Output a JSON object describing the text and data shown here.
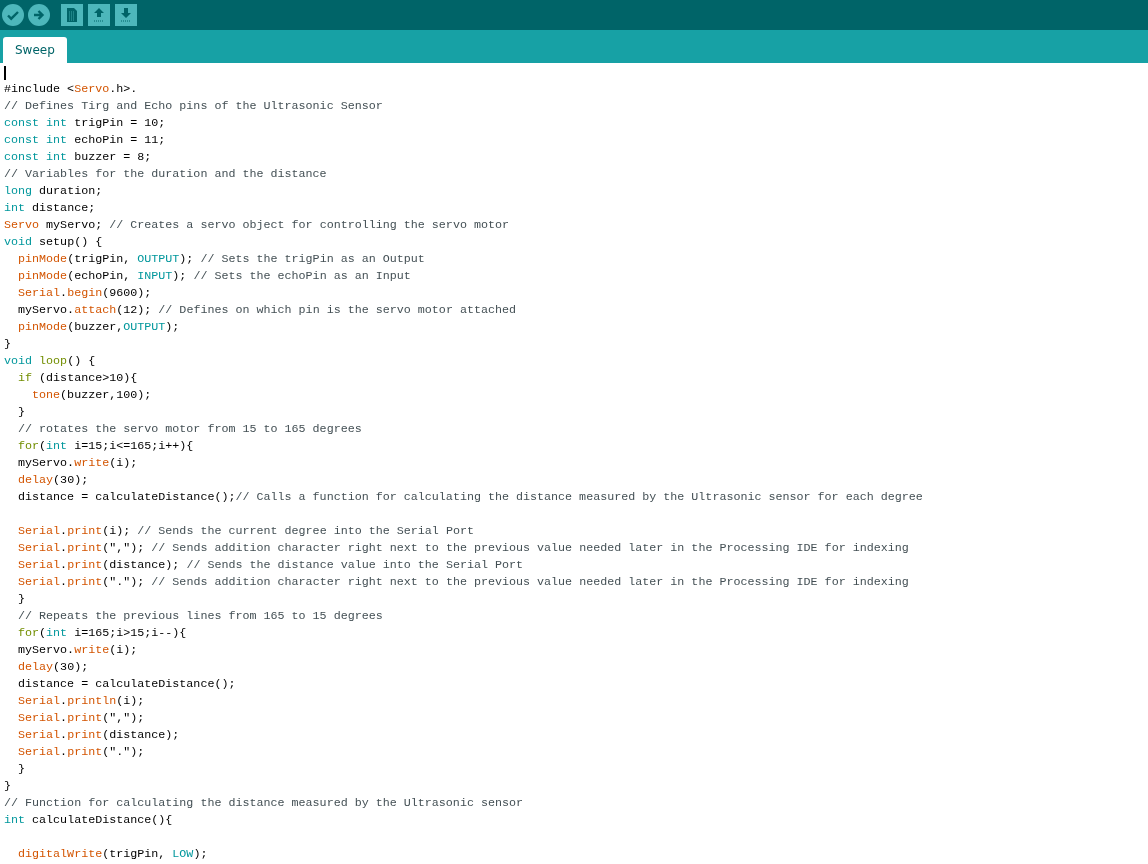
{
  "tabs": [
    {
      "label": "Sweep",
      "selected": true
    }
  ],
  "editor": {
    "lines": [
      {
        "cursor": true
      },
      {
        "tokens": [
          {
            "kind": "plain",
            "text": "#include <"
          },
          {
            "kind": "func",
            "text": "Servo"
          },
          {
            "kind": "plain",
            "text": ".h>."
          }
        ]
      },
      {
        "tokens": [
          {
            "kind": "comment",
            "text": "// Defines Tirg and Echo pins of the Ultrasonic Sensor"
          }
        ]
      },
      {
        "tokens": [
          {
            "kind": "type",
            "text": "const int"
          },
          {
            "kind": "plain",
            "text": " trigPin = 10;"
          }
        ]
      },
      {
        "tokens": [
          {
            "kind": "type",
            "text": "const int"
          },
          {
            "kind": "plain",
            "text": " echoPin = 11;"
          }
        ]
      },
      {
        "tokens": [
          {
            "kind": "type",
            "text": "const int"
          },
          {
            "kind": "plain",
            "text": " buzzer = 8;"
          }
        ]
      },
      {
        "tokens": [
          {
            "kind": "comment",
            "text": "// Variables for the duration and the distance"
          }
        ]
      },
      {
        "tokens": [
          {
            "kind": "type",
            "text": "long"
          },
          {
            "kind": "plain",
            "text": " duration;"
          }
        ]
      },
      {
        "tokens": [
          {
            "kind": "type",
            "text": "int"
          },
          {
            "kind": "plain",
            "text": " distance;"
          }
        ]
      },
      {
        "tokens": [
          {
            "kind": "func",
            "text": "Servo"
          },
          {
            "kind": "plain",
            "text": " myServo; "
          },
          {
            "kind": "comment",
            "text": "// Creates a servo object for controlling the servo motor"
          }
        ]
      },
      {
        "tokens": [
          {
            "kind": "type",
            "text": "void"
          },
          {
            "kind": "plain",
            "text": " setup() {"
          }
        ]
      },
      {
        "tokens": [
          {
            "kind": "func",
            "text": "  pinMode"
          },
          {
            "kind": "plain",
            "text": "(trigPin, "
          },
          {
            "kind": "type",
            "text": "OUTPUT"
          },
          {
            "kind": "plain",
            "text": "); "
          },
          {
            "kind": "comment",
            "text": "// Sets the trigPin as an Output"
          }
        ]
      },
      {
        "tokens": [
          {
            "kind": "func",
            "text": "  pinMode"
          },
          {
            "kind": "plain",
            "text": "(echoPin, "
          },
          {
            "kind": "type",
            "text": "INPUT"
          },
          {
            "kind": "plain",
            "text": "); "
          },
          {
            "kind": "comment",
            "text": "// Sets the echoPin as an Input"
          }
        ]
      },
      {
        "tokens": [
          {
            "kind": "func",
            "text": "  Serial"
          },
          {
            "kind": "plain",
            "text": "."
          },
          {
            "kind": "func",
            "text": "begin"
          },
          {
            "kind": "plain",
            "text": "(9600);"
          }
        ]
      },
      {
        "tokens": [
          {
            "kind": "plain",
            "text": "  myServo."
          },
          {
            "kind": "func",
            "text": "attach"
          },
          {
            "kind": "plain",
            "text": "(12); "
          },
          {
            "kind": "comment",
            "text": "// Defines on which pin is the servo motor attached"
          }
        ]
      },
      {
        "tokens": [
          {
            "kind": "func",
            "text": "  pinMode"
          },
          {
            "kind": "plain",
            "text": "(buzzer,"
          },
          {
            "kind": "type",
            "text": "OUTPUT"
          },
          {
            "kind": "plain",
            "text": ");"
          }
        ]
      },
      {
        "tokens": [
          {
            "kind": "plain",
            "text": "}"
          }
        ]
      },
      {
        "tokens": [
          {
            "kind": "type",
            "text": "void "
          },
          {
            "kind": "ctrl",
            "text": "loop"
          },
          {
            "kind": "plain",
            "text": "() {"
          }
        ]
      },
      {
        "tokens": [
          {
            "kind": "ctrl",
            "text": "  if"
          },
          {
            "kind": "plain",
            "text": " (distance>10){"
          }
        ]
      },
      {
        "tokens": [
          {
            "kind": "func",
            "text": "    tone"
          },
          {
            "kind": "plain",
            "text": "(buzzer,100);"
          }
        ]
      },
      {
        "tokens": [
          {
            "kind": "plain",
            "text": "  }"
          }
        ]
      },
      {
        "tokens": [
          {
            "kind": "comment",
            "text": "  // rotates the servo motor from 15 to 165 degrees"
          }
        ]
      },
      {
        "tokens": [
          {
            "kind": "ctrl",
            "text": "  for"
          },
          {
            "kind": "plain",
            "text": "("
          },
          {
            "kind": "type",
            "text": "int"
          },
          {
            "kind": "plain",
            "text": " i=15;i<=165;i++){"
          }
        ]
      },
      {
        "tokens": [
          {
            "kind": "plain",
            "text": "  myServo."
          },
          {
            "kind": "func",
            "text": "write"
          },
          {
            "kind": "plain",
            "text": "(i);"
          }
        ]
      },
      {
        "tokens": [
          {
            "kind": "func",
            "text": "  delay"
          },
          {
            "kind": "plain",
            "text": "(30);"
          }
        ]
      },
      {
        "tokens": [
          {
            "kind": "plain",
            "text": "  distance = calculateDistance();"
          },
          {
            "kind": "comment",
            "text": "// Calls a function for calculating the distance measured by the Ultrasonic sensor for each degree"
          }
        ]
      },
      {
        "kind": "blank"
      },
      {
        "tokens": [
          {
            "kind": "func",
            "text": "  Serial"
          },
          {
            "kind": "plain",
            "text": "."
          },
          {
            "kind": "func",
            "text": "print"
          },
          {
            "kind": "plain",
            "text": "(i); "
          },
          {
            "kind": "comment",
            "text": "// Sends the current degree into the Serial Port"
          }
        ]
      },
      {
        "tokens": [
          {
            "kind": "func",
            "text": "  Serial"
          },
          {
            "kind": "plain",
            "text": "."
          },
          {
            "kind": "func",
            "text": "print"
          },
          {
            "kind": "plain",
            "text": "(\",\"); "
          },
          {
            "kind": "comment",
            "text": "// Sends addition character right next to the previous value needed later in the Processing IDE for indexing"
          }
        ]
      },
      {
        "tokens": [
          {
            "kind": "func",
            "text": "  Serial"
          },
          {
            "kind": "plain",
            "text": "."
          },
          {
            "kind": "func",
            "text": "print"
          },
          {
            "kind": "plain",
            "text": "(distance); "
          },
          {
            "kind": "comment",
            "text": "// Sends the distance value into the Serial Port"
          }
        ]
      },
      {
        "tokens": [
          {
            "kind": "func",
            "text": "  Serial"
          },
          {
            "kind": "plain",
            "text": "."
          },
          {
            "kind": "func",
            "text": "print"
          },
          {
            "kind": "plain",
            "text": "(\".\"); "
          },
          {
            "kind": "comment",
            "text": "// Sends addition character right next to the previous value needed later in the Processing IDE for indexing"
          }
        ]
      },
      {
        "tokens": [
          {
            "kind": "plain",
            "text": "  }"
          }
        ]
      },
      {
        "tokens": [
          {
            "kind": "comment",
            "text": "  // Repeats the previous lines from 165 to 15 degrees"
          }
        ]
      },
      {
        "tokens": [
          {
            "kind": "ctrl",
            "text": "  for"
          },
          {
            "kind": "plain",
            "text": "("
          },
          {
            "kind": "type",
            "text": "int"
          },
          {
            "kind": "plain",
            "text": " i=165;i>15;i--){"
          }
        ]
      },
      {
        "tokens": [
          {
            "kind": "plain",
            "text": "  myServo."
          },
          {
            "kind": "func",
            "text": "write"
          },
          {
            "kind": "plain",
            "text": "(i);"
          }
        ]
      },
      {
        "tokens": [
          {
            "kind": "func",
            "text": "  delay"
          },
          {
            "kind": "plain",
            "text": "(30);"
          }
        ]
      },
      {
        "tokens": [
          {
            "kind": "plain",
            "text": "  distance = calculateDistance();"
          }
        ]
      },
      {
        "tokens": [
          {
            "kind": "func",
            "text": "  Serial"
          },
          {
            "kind": "plain",
            "text": "."
          },
          {
            "kind": "func",
            "text": "println"
          },
          {
            "kind": "plain",
            "text": "(i);"
          }
        ]
      },
      {
        "tokens": [
          {
            "kind": "func",
            "text": "  Serial"
          },
          {
            "kind": "plain",
            "text": "."
          },
          {
            "kind": "func",
            "text": "print"
          },
          {
            "kind": "plain",
            "text": "(\",\");"
          }
        ]
      },
      {
        "tokens": [
          {
            "kind": "func",
            "text": "  Serial"
          },
          {
            "kind": "plain",
            "text": "."
          },
          {
            "kind": "func",
            "text": "print"
          },
          {
            "kind": "plain",
            "text": "(distance);"
          }
        ]
      },
      {
        "tokens": [
          {
            "kind": "func",
            "text": "  Serial"
          },
          {
            "kind": "plain",
            "text": "."
          },
          {
            "kind": "func",
            "text": "print"
          },
          {
            "kind": "plain",
            "text": "(\".\");"
          }
        ]
      },
      {
        "tokens": [
          {
            "kind": "plain",
            "text": "  }"
          }
        ]
      },
      {
        "tokens": [
          {
            "kind": "plain",
            "text": "}"
          }
        ]
      },
      {
        "tokens": [
          {
            "kind": "comment",
            "text": "// Function for calculating the distance measured by the Ultrasonic sensor"
          }
        ]
      },
      {
        "tokens": [
          {
            "kind": "type",
            "text": "int"
          },
          {
            "kind": "plain",
            "text": " calculateDistance(){"
          }
        ]
      },
      {
        "kind": "blank"
      },
      {
        "tokens": [
          {
            "kind": "func",
            "text": "  digitalWrite"
          },
          {
            "kind": "plain",
            "text": "(trigPin, "
          },
          {
            "kind": "type",
            "text": "LOW"
          },
          {
            "kind": "plain",
            "text": ");"
          }
        ]
      }
    ]
  }
}
